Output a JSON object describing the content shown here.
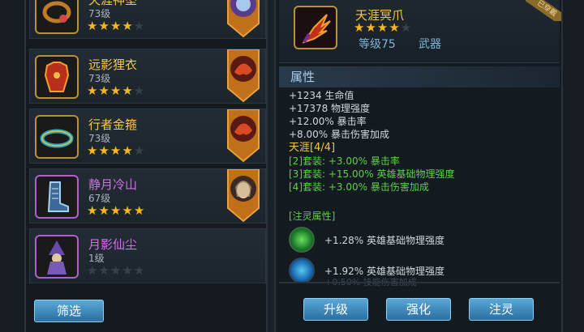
{
  "inventory": {
    "items": [
      {
        "name": "天涯神坠",
        "level": "73级",
        "stars": 4,
        "max_stars": 5,
        "rarity": "gold",
        "icon": "necklace-icon",
        "badge": "purple-orb-badge"
      },
      {
        "name": "远影狸衣",
        "level": "73级",
        "stars": 4,
        "max_stars": 5,
        "rarity": "gold",
        "icon": "armor-icon",
        "badge": "red-beast-badge"
      },
      {
        "name": "行者金箍",
        "level": "73级",
        "stars": 4,
        "max_stars": 5,
        "rarity": "gold",
        "icon": "circlet-icon",
        "badge": "red-beast-badge"
      },
      {
        "name": "静月冷山",
        "level": "67级",
        "stars": 5,
        "max_stars": 5,
        "rarity": "purple",
        "icon": "boots-icon",
        "badge": "hero-portrait-badge"
      },
      {
        "name": "月影仙尘",
        "level": "1级",
        "stars": 0,
        "max_stars": 5,
        "rarity": "purple",
        "icon": "wizard-icon",
        "badge": ""
      }
    ],
    "filter_label": "筛选"
  },
  "detail": {
    "name": "天涯冥爪",
    "stars": 4,
    "max_stars": 5,
    "level": "等级75",
    "type": "武器",
    "ribbon": "已穿戴",
    "section_title": "属性",
    "attributes": [
      "+1234 生命值",
      "+17378 物理强度",
      "+12.00% 暴击率",
      "+8.00% 暴击伤害加成"
    ],
    "set_title": "天涯[4/4]",
    "set_bonuses": [
      "[2]套装: +3.00% 暴击率",
      "[3]套装: +15.00% 英雄基础物理强度",
      "[4]套装: +3.00% 暴击伤害加成"
    ],
    "infuse_title": "[注灵属性]",
    "infusions": [
      {
        "text": "+1.28% 英雄基础物理强度",
        "color": "#2faa3a"
      },
      {
        "text": "+1.92% 英雄基础物理强度",
        "color": "#1f8ed8"
      }
    ],
    "faded_line": "+0.50% 技能伤害加成"
  },
  "actions": {
    "upgrade": "升级",
    "enhance": "强化",
    "infuse": "注灵"
  },
  "colors": {
    "gold_text": "#f2c84a",
    "purple_text": "#d070e8",
    "set_green": "#5cd048",
    "button_blue": "#2a6fa0"
  }
}
